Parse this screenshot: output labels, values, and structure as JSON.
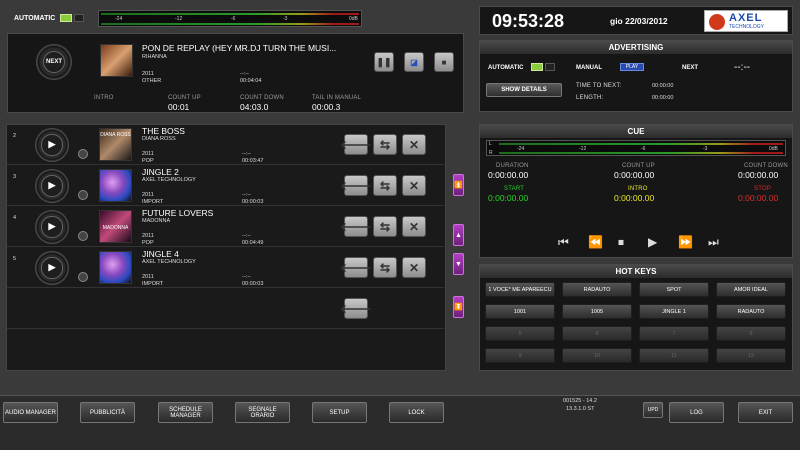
{
  "top": {
    "automatic_label": "AUTOMATIC",
    "meter_ticks": [
      "-24",
      "-12",
      "-6",
      "-3",
      "0dB"
    ],
    "clock": "09:53:28",
    "date": "gio 22/03/2012",
    "logo_main": "AXEL",
    "logo_sub": "TECHNOLOGY"
  },
  "player": {
    "next_label": "NEXT",
    "title": "PON DE REPLAY (HEY MR.DJ TURN THE MUSI...",
    "artist": "RIHANNA",
    "year": "2011",
    "category": "OTHER",
    "blank_time": "--:--",
    "duration": "00:04:04",
    "intro_label": "INTRO",
    "count_up_label": "COUNT UP",
    "count_up": "00:01",
    "count_down_label": "COUNT DOWN",
    "count_down": "04:03.0",
    "tail_label": "TAIL IN MANUAL",
    "tail": "00:00.3"
  },
  "playlist": [
    {
      "num": "2",
      "title": "THE BOSS",
      "artist": "DIANA ROSS",
      "year": "2011",
      "category": "POP",
      "blank": "--:--",
      "duration": "00:03:47",
      "cover_text": "DIANA ROSS",
      "color": "#b08a6a"
    },
    {
      "num": "3",
      "title": "JINGLE 2",
      "artist": "AXEL TECHNOLOGY",
      "year": "2011",
      "category": "IMPORT",
      "blank": "--:--",
      "duration": "00:00:03",
      "cover_text": "",
      "color": "#8a4ac0"
    },
    {
      "num": "4",
      "title": "FUTURE LOVERS",
      "artist": "MADONNA",
      "year": "2011",
      "category": "POP",
      "blank": "--:--",
      "duration": "00:04:49",
      "cover_text": "MADONNA",
      "color": "#c04a7a"
    },
    {
      "num": "5",
      "title": "JINGLE 4",
      "artist": "AXEL TECHNOLOGY",
      "year": "2011",
      "category": "IMPORT",
      "blank": "--:--",
      "duration": "00:00:03",
      "cover_text": "",
      "color": "#8a4ac0"
    }
  ],
  "advertising": {
    "title": "ADVERTISING",
    "automatic": "AUTOMATIC",
    "manual": "MANUAL",
    "play": "PLAY",
    "next": "NEXT",
    "next_val": "--:--",
    "show_details": "SHOW DETAILS",
    "time_to_next_label": "TIME TO NEXT:",
    "time_to_next": "00:00:00",
    "length_label": "LENGTH:",
    "length": "00:00:00"
  },
  "cue": {
    "title": "CUE",
    "meter_ticks": [
      "-24",
      "-12",
      "-6",
      "-3",
      "0dB"
    ],
    "ch_l": "L",
    "ch_r": "R",
    "duration_label": "DURATION",
    "duration": "0:00:00.00",
    "count_up_label": "COUNT UP",
    "count_up": "0:00:00.00",
    "count_down_label": "COUNT DOWN",
    "count_down": "0:00:00.00",
    "start_label": "START",
    "start": "0:00:00.00",
    "intro_label": "INTRO",
    "intro": "0:00:00.00",
    "stop_label": "STOP",
    "stop": "0:00:00.00"
  },
  "hotkeys": {
    "title": "HOT KEYS",
    "keys": [
      "1 VOCE* ME APAREECU",
      "RADAUTO",
      "SPOT",
      "AMOR IDEAL",
      "1001",
      "1005",
      "JINGLE 1",
      "RADAUTO",
      "5",
      "6",
      "7",
      "8",
      "9",
      "10",
      "11",
      "12"
    ]
  },
  "bottom": {
    "buttons": [
      "AUDIO MANAGER",
      "PUBBLICITÀ",
      "SCHEDULE MANAGER",
      "SEGNALE ORARIO",
      "SETUP",
      "LOCK"
    ],
    "version1": "001525 - 14.2",
    "version2": "13.3.1.0 ST",
    "upd": "UPD",
    "log": "LOG",
    "exit": "EXIT"
  },
  "colors": {
    "green": "#2ad02a",
    "yellow": "#e8e82a",
    "red": "#e02a2a",
    "accent": "#b23fc4"
  }
}
